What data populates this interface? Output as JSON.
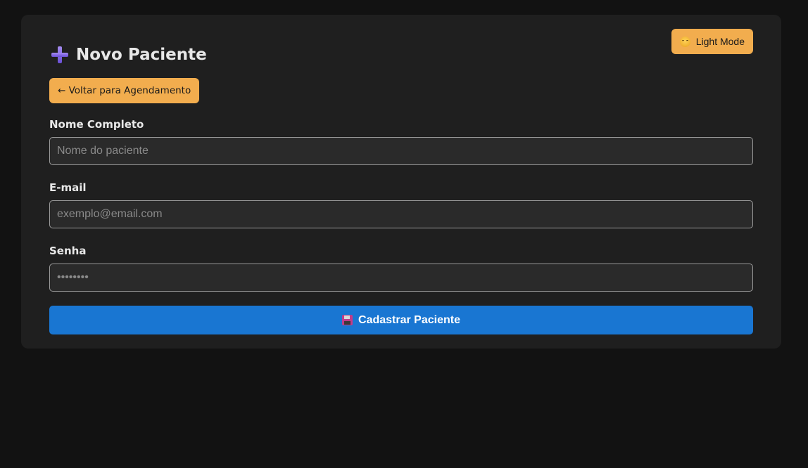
{
  "header": {
    "title": "Novo Paciente",
    "theme_toggle_label": "Light Mode",
    "back_label": "← Voltar para Agendamento"
  },
  "form": {
    "name": {
      "label": "Nome Completo",
      "placeholder": "Nome do paciente",
      "value": ""
    },
    "email": {
      "label": "E-mail",
      "placeholder": "exemplo@email.com",
      "value": ""
    },
    "password": {
      "label": "Senha",
      "placeholder": "••••••••",
      "value": ""
    },
    "submit_label": "Cadastrar Paciente"
  },
  "icons": {
    "title": "plus-icon",
    "theme": "smiley-icon",
    "submit": "floppy-disk-icon"
  },
  "colors": {
    "background": "#121212",
    "card": "#1f1f1f",
    "accent": "#f2ad4e",
    "primary": "#1976d2",
    "title_icon": "#7b5fe0"
  }
}
